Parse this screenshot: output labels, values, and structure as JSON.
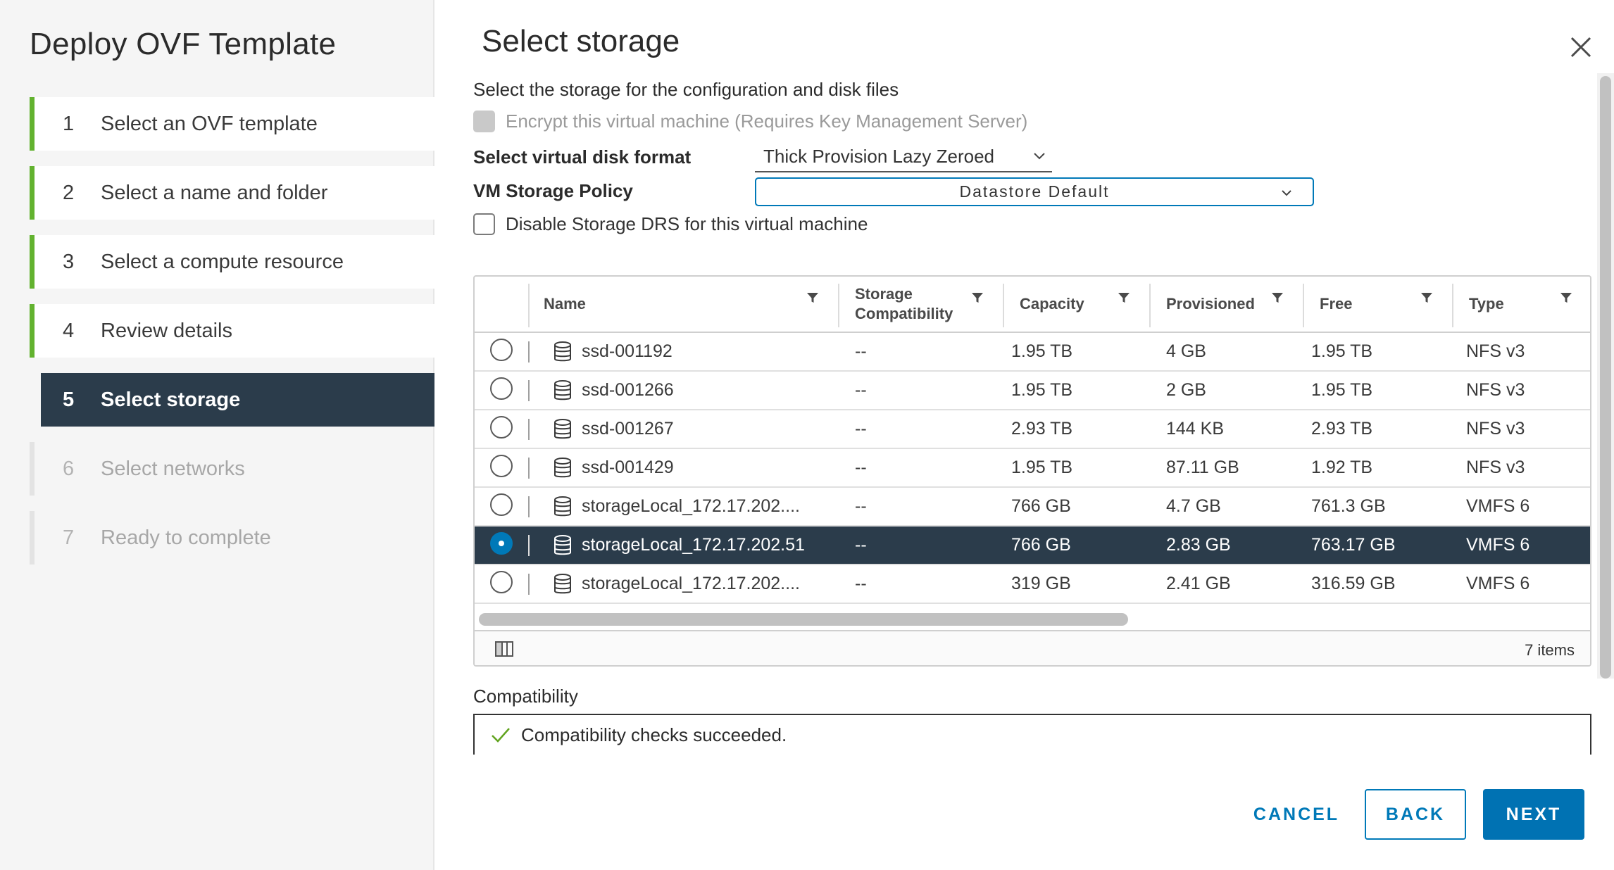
{
  "wizard": {
    "title": "Deploy OVF Template",
    "steps": [
      {
        "num": "1",
        "label": "Select an OVF template",
        "state": "completed"
      },
      {
        "num": "2",
        "label": "Select a name and folder",
        "state": "completed"
      },
      {
        "num": "3",
        "label": "Select a compute resource",
        "state": "completed"
      },
      {
        "num": "4",
        "label": "Review details",
        "state": "completed"
      },
      {
        "num": "5",
        "label": "Select storage",
        "state": "active"
      },
      {
        "num": "6",
        "label": "Select networks",
        "state": "disabled"
      },
      {
        "num": "7",
        "label": "Ready to complete",
        "state": "disabled"
      }
    ]
  },
  "page": {
    "title": "Select storage",
    "subtitle": "Select the storage for the configuration and disk files",
    "encrypt_label": "Encrypt this virtual machine (Requires Key Management Server)",
    "disk_format_label": "Select virtual disk format",
    "disk_format_value": "Thick Provision Lazy Zeroed",
    "policy_label": "VM Storage Policy",
    "policy_value": "Datastore Default",
    "drs_label": "Disable Storage DRS for this virtual machine"
  },
  "grid": {
    "columns": [
      "Name",
      "Storage Compatibility",
      "Capacity",
      "Provisioned",
      "Free",
      "Type"
    ],
    "column_storage_line1": "Storage",
    "column_storage_line2": "Compatibility",
    "rows": [
      {
        "name": "ssd-001192",
        "compat": "--",
        "capacity": "1.95 TB",
        "provisioned": "4 GB",
        "free": "1.95 TB",
        "type": "NFS v3",
        "selected": false
      },
      {
        "name": "ssd-001266",
        "compat": "--",
        "capacity": "1.95 TB",
        "provisioned": "2 GB",
        "free": "1.95 TB",
        "type": "NFS v3",
        "selected": false
      },
      {
        "name": "ssd-001267",
        "compat": "--",
        "capacity": "2.93 TB",
        "provisioned": "144 KB",
        "free": "2.93 TB",
        "type": "NFS v3",
        "selected": false
      },
      {
        "name": "ssd-001429",
        "compat": "--",
        "capacity": "1.95 TB",
        "provisioned": "87.11 GB",
        "free": "1.92 TB",
        "type": "NFS v3",
        "selected": false
      },
      {
        "name": "storageLocal_172.17.202....",
        "compat": "--",
        "capacity": "766 GB",
        "provisioned": "4.7 GB",
        "free": "761.3 GB",
        "type": "VMFS 6",
        "selected": false
      },
      {
        "name": "storageLocal_172.17.202.51",
        "compat": "--",
        "capacity": "766 GB",
        "provisioned": "2.83 GB",
        "free": "763.17 GB",
        "type": "VMFS 6",
        "selected": true
      },
      {
        "name": "storageLocal_172.17.202....",
        "compat": "--",
        "capacity": "319 GB",
        "provisioned": "2.41 GB",
        "free": "316.59 GB",
        "type": "VMFS 6",
        "selected": false
      }
    ],
    "items_count": "7 items"
  },
  "compatibility": {
    "label": "Compatibility",
    "message": "Compatibility checks succeeded."
  },
  "buttons": {
    "cancel": "CANCEL",
    "back": "BACK",
    "next": "NEXT"
  },
  "colors": {
    "accent": "#0079b8",
    "progress_green": "#62b22f",
    "active_step_bg": "#2b3c4b",
    "selected_row_bg": "#2b3c4b"
  }
}
